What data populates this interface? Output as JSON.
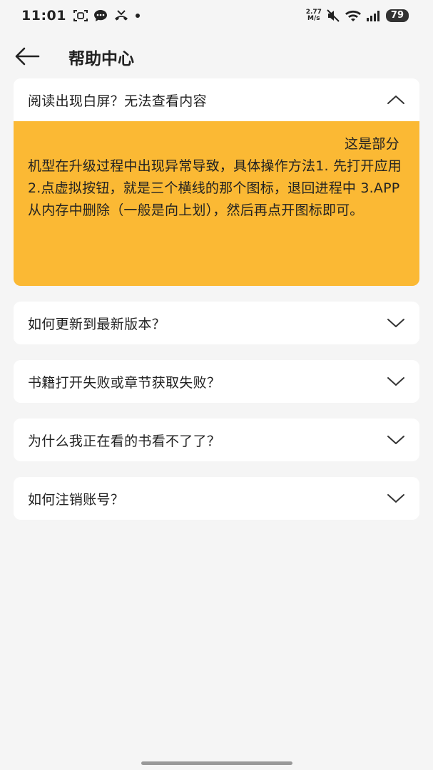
{
  "status": {
    "time": "11:01",
    "net_speed_value": "2.77",
    "net_speed_unit": "M/s",
    "battery": "79"
  },
  "header": {
    "title": "帮助中心"
  },
  "faq": [
    {
      "question": "阅读出现白屏？无法查看内容",
      "expanded": true,
      "answer": "这是部分机型在升级过程中出现异常导致，具体操作方法1. 先打开应用 2.点虚拟按钮，就是三个横线的那个图标，退回进程中 3.APP从内存中删除（一般是向上划），然后再点开图标即可。"
    },
    {
      "question": "如何更新到最新版本？",
      "expanded": false
    },
    {
      "question": "书籍打开失败或章节获取失败？",
      "expanded": false
    },
    {
      "question": "为什么我正在看的书看不了了？",
      "expanded": false
    },
    {
      "question": "如何注销账号？",
      "expanded": false
    }
  ],
  "colors": {
    "answer_bg": "#fbb934",
    "page_bg": "#f5f5f5",
    "card_bg": "#ffffff"
  },
  "icons": {
    "back": "arrow-left-icon",
    "expanded": "chevron-up-icon",
    "collapsed": "chevron-down-icon"
  }
}
